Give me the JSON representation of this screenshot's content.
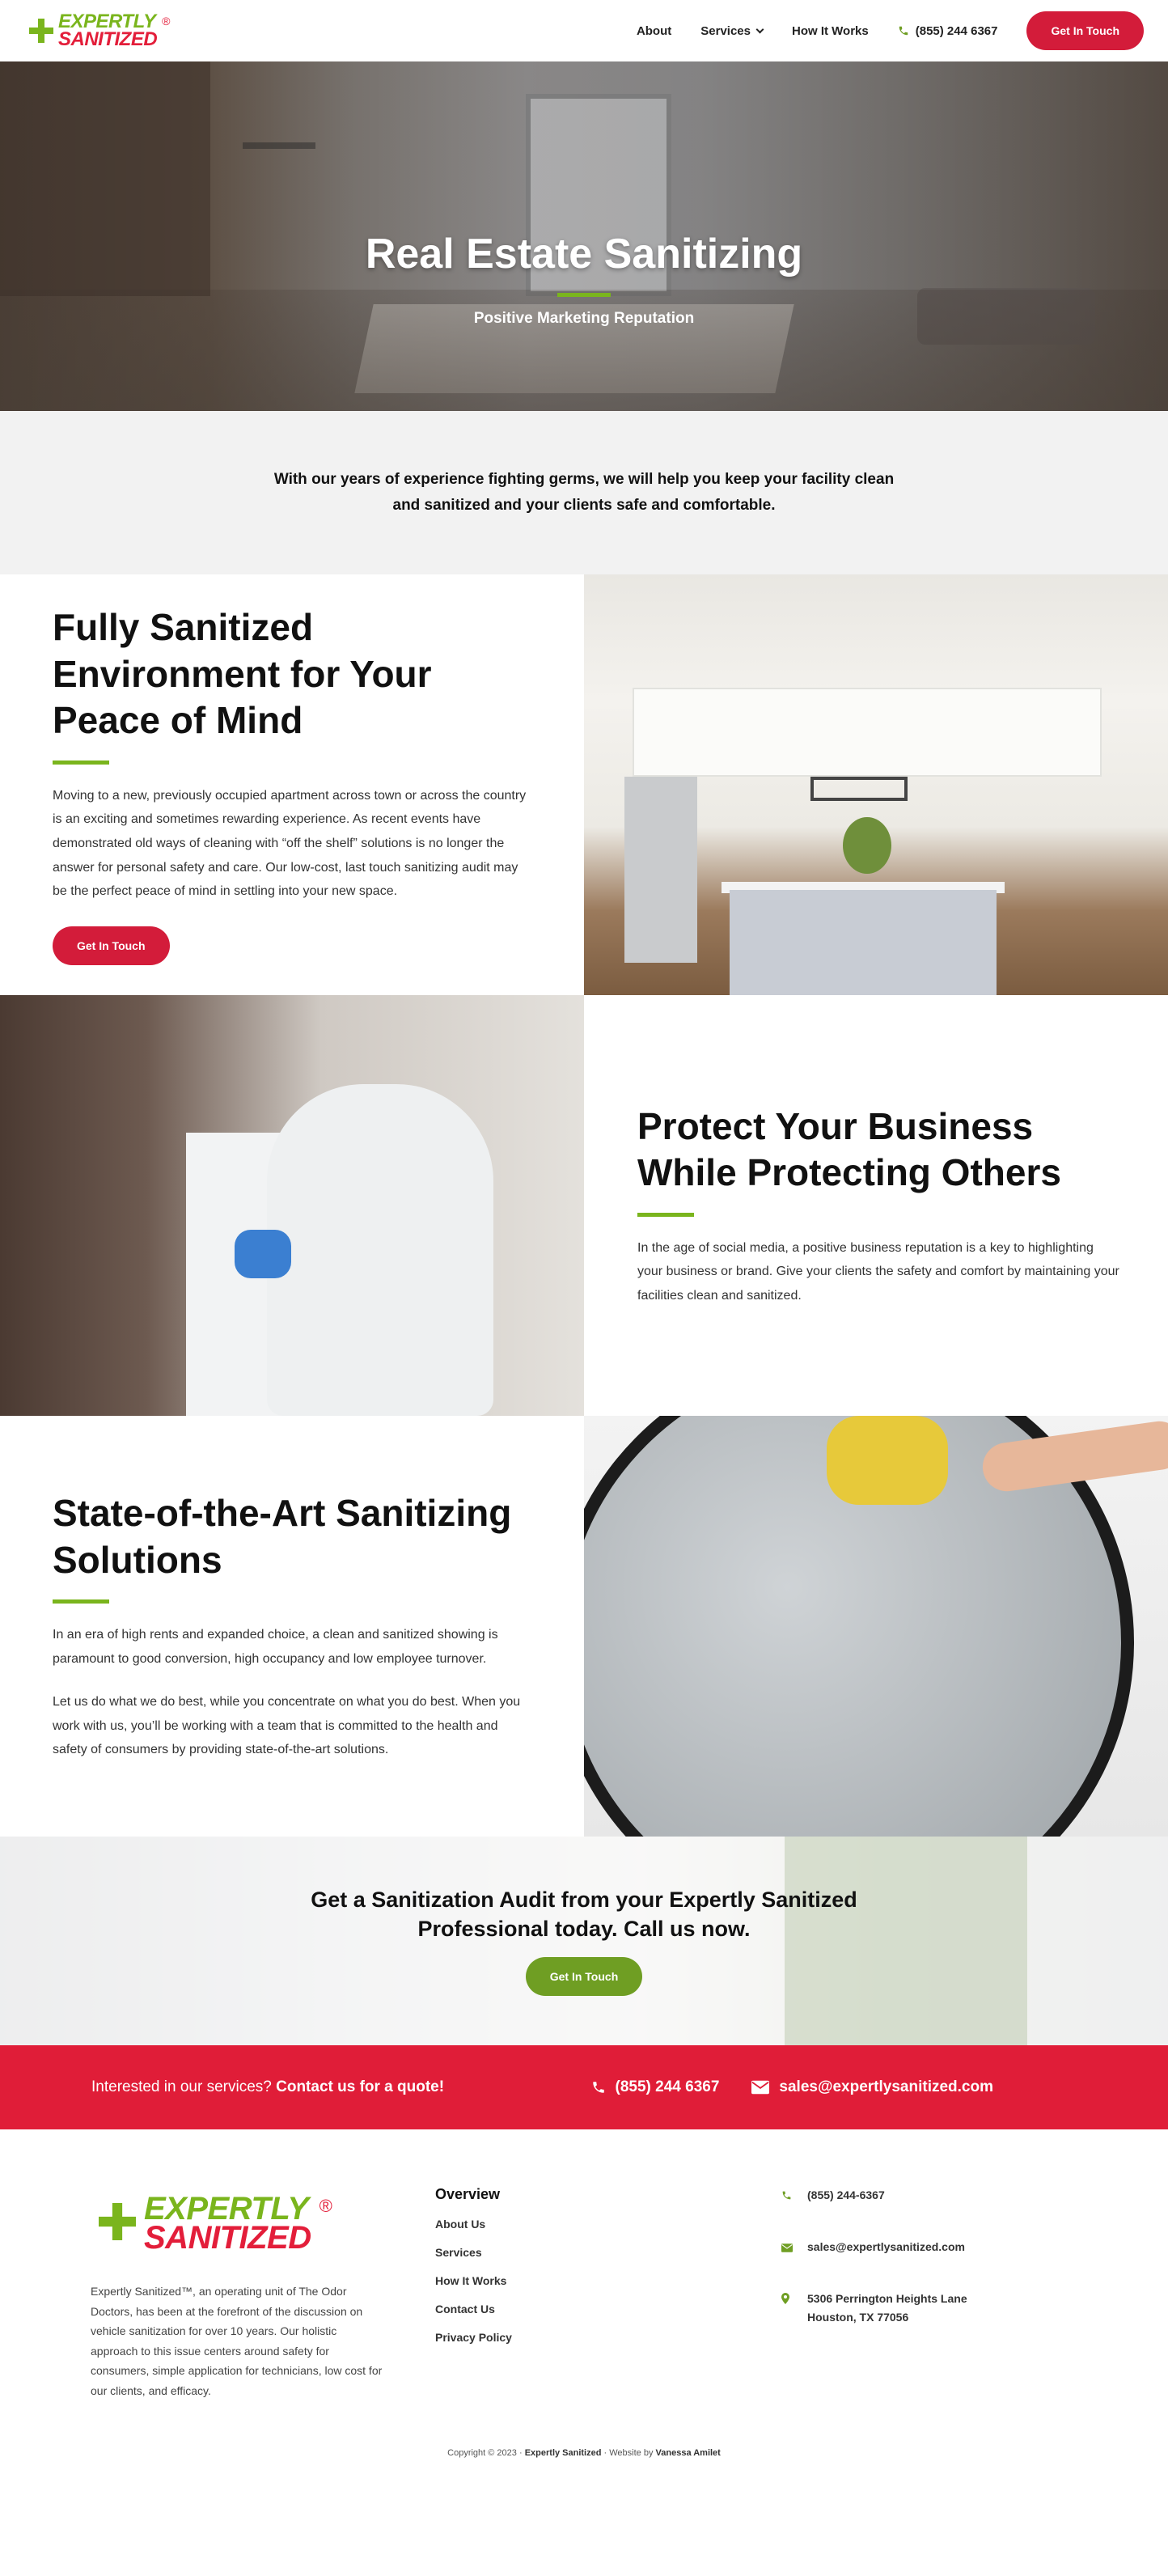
{
  "brand": {
    "line1": "EXPERTLY",
    "line2": "SANITIZED",
    "reg": "®",
    "green": "#7ab51d",
    "red": "#e31e3a"
  },
  "nav": {
    "items": [
      "About",
      "Services",
      "How It Works"
    ],
    "phone": "(855) 244 6367",
    "cta": "Get In Touch"
  },
  "hero": {
    "title": "Real Estate Sanitizing",
    "subtitle": "Positive Marketing Reputation"
  },
  "intro": {
    "text": "With our years of experience fighting germs, we will help you keep your facility clean and sanitized and your clients safe and comfortable."
  },
  "sections": [
    {
      "title": "Fully Sanitized Environment for Your Peace of Mind",
      "body": "Moving to a new, previously occupied apartment across town or across the country is an exciting and sometimes rewarding experience. As recent events have demonstrated old ways of cleaning with “off the shelf” solutions is no longer the answer for personal safety and care. Our low-cost, last touch sanitizing audit may be the perfect peace of mind in settling into your new space.",
      "button": "Get In Touch"
    },
    {
      "title": "Protect Your Business While Protecting Others",
      "body": "In the age of social media, a positive business reputation is a key to highlighting your business or brand. Give your clients the safety and comfort by maintaining your facilities clean and sanitized."
    },
    {
      "title": "State-of-the-Art Sanitizing Solutions",
      "body": "In an era of high rents and expanded choice, a clean and sanitized showing is paramount to good conversion, high occupancy and low employee turnover.",
      "body2": "Let us do what we do best, while you concentrate on what you do best. When you work with us, you’ll be working with a team that is committed to the health and safety of consumers by providing state-of-the-art solutions."
    }
  ],
  "cta": {
    "title": "Get a Sanitization Audit from your Expertly Sanitized Professional today. Call us now.",
    "button": "Get In Touch"
  },
  "contact_band": {
    "prefix": "Interested in our services?",
    "link": "Contact us for a quote!",
    "phone": "(855) 244 6367",
    "email": "sales@expertlysanitized.com"
  },
  "footer": {
    "description": "Expertly Sanitized™, an operating unit of The Odor Doctors, has been at the forefront of the discussion on vehicle sanitization for over 10 years. Our holistic approach to this issue centers around safety for consumers, simple application for technicians, low cost for our clients, and efficacy.",
    "overview_title": "Overview",
    "links": [
      "About Us",
      "Services",
      "How It Works",
      "Contact Us",
      "Privacy Policy"
    ],
    "phone": "(855) 244-6367",
    "email": "sales@expertlysanitized.com",
    "address1": "5306 Perrington Heights Lane",
    "address2": "Houston, TX 77056",
    "copyright_prefix": "Copyright © 2023 ·",
    "copyright_brand": "Expertly Sanitized",
    "copyright_mid": "· Website by",
    "copyright_author": "Vanessa Amilet"
  }
}
